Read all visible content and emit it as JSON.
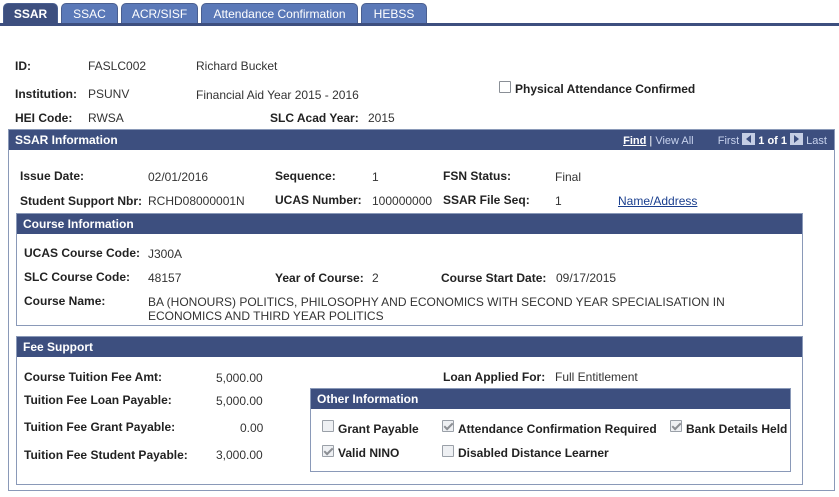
{
  "tabs": [
    {
      "label": "SSAR",
      "active": true
    },
    {
      "label": "SSAC",
      "active": false
    },
    {
      "label": "ACR/SISF",
      "active": false
    },
    {
      "label": "Attendance Confirmation",
      "active": false
    },
    {
      "label": "HEBSS",
      "active": false
    }
  ],
  "header": {
    "id_label": "ID:",
    "id_value": "FASLC002",
    "name": "Richard Bucket",
    "institution_label": "Institution:",
    "institution_value": "PSUNV",
    "aid_year": "Financial Aid Year 2015 - 2016",
    "hei_label": "HEI Code:",
    "hei_value": "RWSA",
    "slc_year_label": "SLC Acad Year:",
    "slc_year_value": "2015",
    "physical_attendance_label": "Physical Attendance Confirmed",
    "physical_attendance_checked": false
  },
  "ssar": {
    "title": "SSAR Information",
    "nav": {
      "find": "Find",
      "view_all": "View All",
      "first": "First",
      "count": "1 of 1",
      "last": "Last"
    },
    "issue_date_label": "Issue Date:",
    "issue_date_value": "02/01/2016",
    "sequence_label": "Sequence:",
    "sequence_value": "1",
    "fsn_label": "FSN Status:",
    "fsn_value": "Final",
    "ssn_label": "Student Support Nbr:",
    "ssn_value": "RCHD08000001N",
    "ucas_label": "UCAS Number:",
    "ucas_value": "100000000",
    "filseq_label": "SSAR File Seq:",
    "filseq_value": "1",
    "name_address_link": "Name/Address"
  },
  "course": {
    "title": "Course Information",
    "ucas_code_label": "UCAS Course Code:",
    "ucas_code_value": "J300A",
    "slc_code_label": "SLC Course Code:",
    "slc_code_value": "48157",
    "year_label": "Year of Course:",
    "year_value": "2",
    "start_label": "Course Start Date:",
    "start_value": "09/17/2015",
    "name_label": "Course Name:",
    "name_line1": "BA (HONOURS) POLITICS, PHILOSOPHY AND ECONOMICS WITH SECOND YEAR SPECIALISATION IN",
    "name_line2": "ECONOMICS AND THIRD YEAR POLITICS"
  },
  "fee": {
    "title": "Fee Support",
    "tuition_label": "Course Tuition Fee Amt:",
    "tuition_value": "5,000.00",
    "loan_label": "Tuition Fee Loan Payable:",
    "loan_value": "5,000.00",
    "grant_label": "Tuition Fee Grant Payable:",
    "grant_value": "0.00",
    "student_label": "Tuition Fee Student Payable:",
    "student_value": "3,000.00",
    "loan_applied_label": "Loan Applied For:",
    "loan_applied_value": "Full Entitlement"
  },
  "other": {
    "title": "Other Information",
    "grant_payable": {
      "label": "Grant Payable",
      "checked": false
    },
    "attendance_required": {
      "label": "Attendance Confirmation Required",
      "checked": true
    },
    "bank_details": {
      "label": "Bank Details Held",
      "checked": true
    },
    "valid_nino": {
      "label": "Valid NINO",
      "checked": true
    },
    "disabled_distance": {
      "label": "Disabled Distance Learner",
      "checked": false
    }
  },
  "colors": {
    "header_bar": "#3d4f7f",
    "tab": "#5b79b8",
    "link": "#1a3f8f"
  }
}
